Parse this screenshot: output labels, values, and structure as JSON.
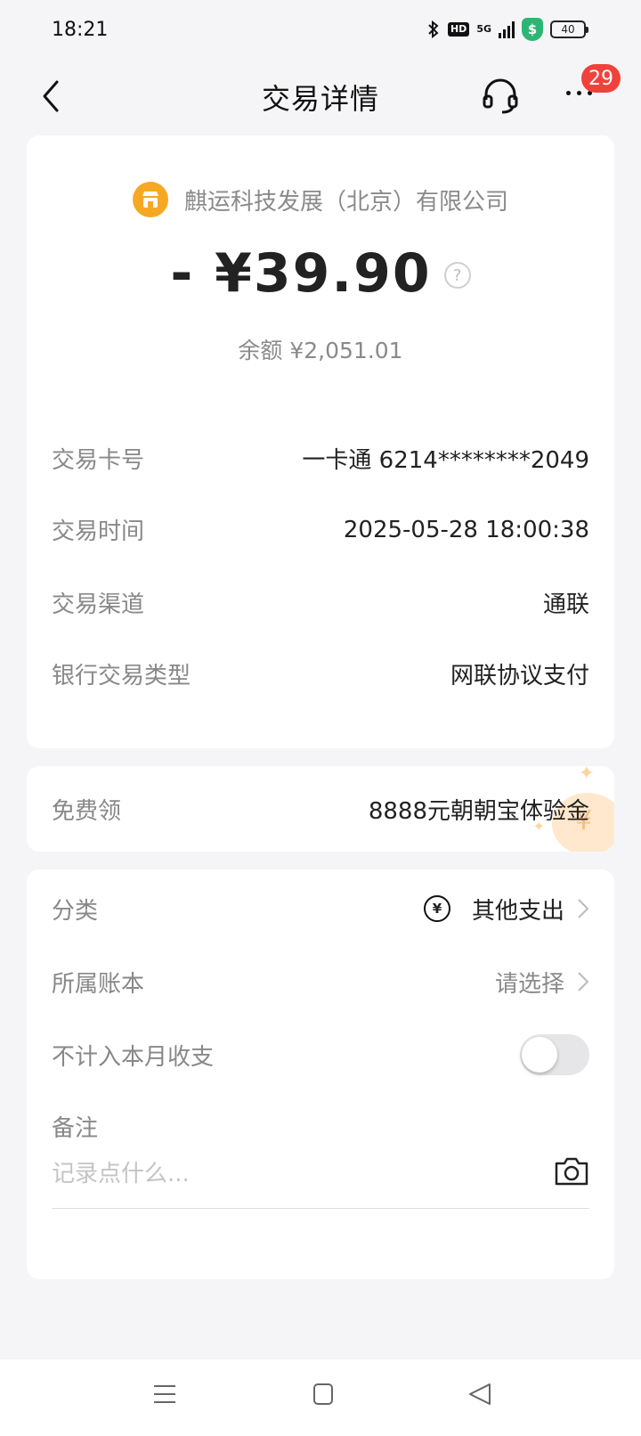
{
  "status_bar": {
    "time": "18:21",
    "network": "5G",
    "hd": "HD",
    "shield_glyph": "$",
    "battery": "40"
  },
  "nav": {
    "title": "交易详情",
    "badge_count": "29"
  },
  "transaction": {
    "merchant": "麒运科技发展（北京）有限公司",
    "amount": "- ¥39.90",
    "help_glyph": "?",
    "balance": "余额 ¥2,051.01"
  },
  "details": [
    {
      "label": "交易卡号",
      "value": "一卡通 6214********2049"
    },
    {
      "label": "交易时间",
      "value": "2025-05-28 18:00:38"
    },
    {
      "label": "交易渠道",
      "value": "通联"
    },
    {
      "label": "银行交易类型",
      "value": "网联协议支付"
    }
  ],
  "promo": {
    "label": "免费领",
    "value": "8888元朝朝宝体验金"
  },
  "settings": {
    "category_label": "分类",
    "category_icon_glyph": "¥",
    "category_value": "其他支出",
    "book_label": "所属账本",
    "book_value": "请选择",
    "exclude_label": "不计入本月收支",
    "exclude_enabled": false,
    "note_label": "备注",
    "note_placeholder": "记录点什么...",
    "note_value": ""
  },
  "icons": {
    "back": "chevron-left-icon",
    "service": "headset-icon",
    "more": "more-dots-icon",
    "merchant": "store-icon",
    "help": "question-circle-icon",
    "category": "yuan-circle-icon",
    "chevron": "chevron-right-icon",
    "camera": "camera-icon",
    "menu": "menu-lines-icon",
    "home": "square-icon",
    "back_sys": "triangle-back-icon"
  },
  "colors": {
    "page_bg": "#f5f5f7",
    "card_bg": "#ffffff",
    "badge": "#f0413a",
    "merchant_icon": "#f7a823",
    "shield": "#2bb673"
  }
}
